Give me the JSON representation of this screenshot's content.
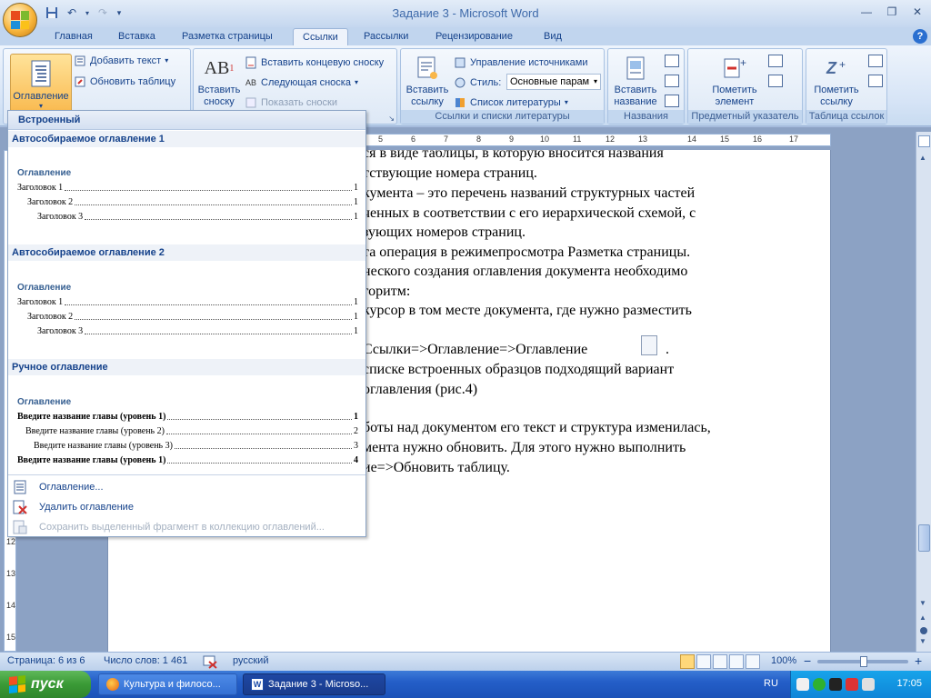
{
  "window": {
    "title": "Задание  3 - Microsoft Word",
    "qat_save": "save-icon",
    "controls": [
      "minimize",
      "maximize",
      "close"
    ]
  },
  "tabs": [
    {
      "label": "Главная"
    },
    {
      "label": "Вставка"
    },
    {
      "label": "Разметка страницы"
    },
    {
      "label": "Ссылки",
      "active": true
    },
    {
      "label": "Рассылки"
    },
    {
      "label": "Рецензирование"
    },
    {
      "label": "Вид"
    }
  ],
  "ribbon": {
    "toc_group": {
      "toc_button": "Оглавление",
      "add_text": "Добавить текст",
      "update_table": "Обновить таблицу"
    },
    "footnotes_group": {
      "insert_footnote_line1": "Вставить",
      "insert_footnote_line2": "сноску",
      "insert_endnote": "Вставить концевую сноску",
      "next_footnote": "Следующая сноска",
      "show_notes": "Показать сноски"
    },
    "citations_group": {
      "insert_citation_line1": "Вставить",
      "insert_citation_line2": "ссылку",
      "manage_sources": "Управление источниками",
      "style_label": "Стиль:",
      "style_value": "Основные парам",
      "bibliography": "Список литературы",
      "label": "Ссылки и списки литературы"
    },
    "captions_group": {
      "insert_caption_line1": "Вставить",
      "insert_caption_line2": "название",
      "label": "Названия"
    },
    "index_group": {
      "mark_entry_line1": "Пометить",
      "mark_entry_line2": "элемент",
      "label": "Предметный указатель"
    },
    "citations_table_group": {
      "mark_citation_line1": "Пометить",
      "mark_citation_line2": "ссылку",
      "label": "Таблица ссылок"
    }
  },
  "ruler_marks": [
    "5",
    "6",
    "7",
    "8",
    "9",
    "10",
    "11",
    "12",
    "13",
    "14",
    "15",
    "16",
    "17"
  ],
  "ruler_v_marks": [
    "12",
    "13",
    "14",
    "15"
  ],
  "document": {
    "lines": [
      "ся в виде таблицы, в которую вносится названия",
      "тствующие номера страниц.",
      "кумента – это перечень названий структурных частей",
      "ченных в соответствии с его иерархической схемой, с",
      "зующих номеров страниц.",
      "та операция в режимепросмотра Разметка страницы.",
      "неского создания оглавления документа необходимо",
      "горитм:",
      "курсор в том месте документа, где нужно разместить",
      "Ссылки=>Оглавление=>Оглавление",
      "списке встроенных образцов подходящий вариант",
      "оглавления (рис.4)",
      "боты над документом его текст и структура изменилась,",
      "мента нужно обновить. Для этого нужно выполнить",
      "ие=>Обновить таблицу."
    ],
    "trailing_period": "."
  },
  "dropdown": {
    "header": "Встроенный",
    "sections": [
      {
        "title": "Автособираемое оглавление 1",
        "heading": "Оглавление",
        "entries": [
          {
            "text": "Заголовок 1",
            "page": "1",
            "level": 1,
            "bold": false
          },
          {
            "text": "Заголовок 2",
            "page": "1",
            "level": 2,
            "bold": false
          },
          {
            "text": "Заголовок 3",
            "page": "1",
            "level": 3,
            "bold": false
          }
        ]
      },
      {
        "title": "Автособираемое оглавление 2",
        "heading": "Оглавление",
        "entries": [
          {
            "text": "Заголовок 1",
            "page": "1",
            "level": 1,
            "bold": false
          },
          {
            "text": "Заголовок 2",
            "page": "1",
            "level": 2,
            "bold": false
          },
          {
            "text": "Заголовок 3",
            "page": "1",
            "level": 3,
            "bold": false
          }
        ]
      },
      {
        "title": "Ручное оглавление",
        "heading": "Оглавление",
        "entries": [
          {
            "text": "Введите название главы (уровень 1)",
            "page": "1",
            "level": 1,
            "bold": true
          },
          {
            "text": "Введите название главы (уровень 2)",
            "page": "2",
            "level": 2,
            "bold": false
          },
          {
            "text": "Введите название главы (уровень 3)",
            "page": "3",
            "level": 3,
            "bold": false
          },
          {
            "text": "Введите название главы (уровень 1)",
            "page": "4",
            "level": 1,
            "bold": true
          }
        ]
      }
    ],
    "menu": {
      "toc_dialog": "Оглавление...",
      "remove_toc": "Удалить оглавление",
      "save_selection": "Сохранить выделенный фрагмент в коллекцию оглавлений..."
    }
  },
  "statusbar": {
    "page": "Страница: 6 из 6",
    "words": "Число слов: 1 461",
    "language": "русский",
    "zoom": "100%",
    "zoom_minus": "−",
    "zoom_plus": "+"
  },
  "taskbar": {
    "start": "пуск",
    "task1": "Культура и филосо...",
    "task2": "Задание  3 - Microso...",
    "lang": "RU",
    "clock": "17:05"
  },
  "colors": {
    "ribbon_text": "#15428b",
    "accent_orange": "#f9b74a",
    "taskbar_blue": "#245ec8",
    "start_green": "#3a9a36"
  }
}
